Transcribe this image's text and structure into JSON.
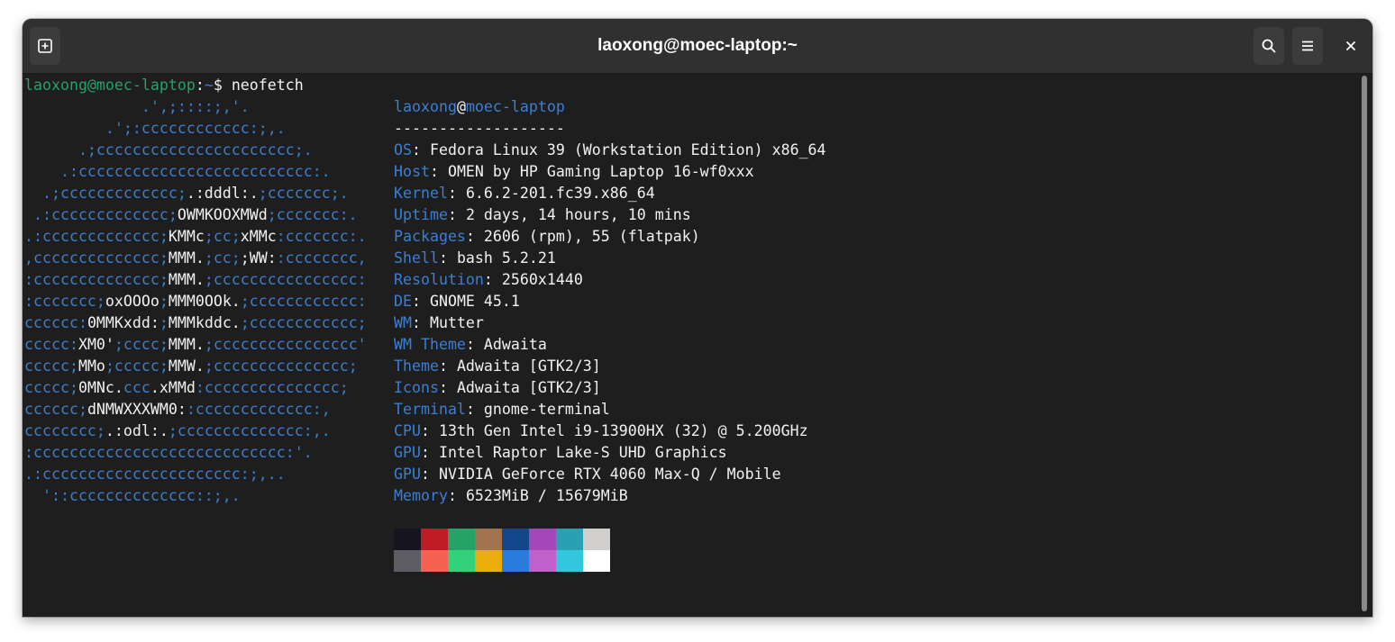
{
  "window": {
    "title": "laoxong@moec-laptop:~"
  },
  "header": {
    "new_tab_icon": "new-tab-icon",
    "search_icon": "search-icon",
    "menu_icon": "hamburger-menu-icon",
    "close_icon": "close-icon"
  },
  "prompt": {
    "user_host": "laoxong@moec-laptop",
    "sep": ":",
    "path": "~",
    "symbol": "$ ",
    "command": "neofetch"
  },
  "logo": [
    [
      [
        "b",
        "             .',;::::;,'."
      ]
    ],
    [
      [
        "b",
        "         .';:cccccccccccc:;,."
      ]
    ],
    [
      [
        "b",
        "      .;cccccccccccccccccccccc;."
      ]
    ],
    [
      [
        "b",
        "    .:cccccccccccccccccccccccccc:."
      ]
    ],
    [
      [
        "b",
        "  .;ccccccccccccc;"
      ],
      [
        "w",
        ".:dddl:."
      ],
      [
        "b",
        ";ccccccc;."
      ]
    ],
    [
      [
        "b",
        " .:ccccccccccccc;"
      ],
      [
        "w",
        "OWMKOOXMWd"
      ],
      [
        "b",
        ";ccccccc:."
      ]
    ],
    [
      [
        "b",
        ".:ccccccccccccc;"
      ],
      [
        "w",
        "KMMc"
      ],
      [
        "b",
        ";cc;"
      ],
      [
        "w",
        "xMMc"
      ],
      [
        "b",
        ":ccccccc:."
      ]
    ],
    [
      [
        "b",
        ",cccccccccccccc;"
      ],
      [
        "w",
        "MMM."
      ],
      [
        "b",
        ";cc;"
      ],
      [
        "w",
        ";WW:"
      ],
      [
        "b",
        ":cccccccc,"
      ]
    ],
    [
      [
        "b",
        ":cccccccccccccc;"
      ],
      [
        "w",
        "MMM."
      ],
      [
        "b",
        ";cccccccccccccccc:"
      ]
    ],
    [
      [
        "b",
        ":ccccccc;"
      ],
      [
        "w",
        "oxOOOo"
      ],
      [
        "b",
        ";"
      ],
      [
        "w",
        "MMM0OOk."
      ],
      [
        "b",
        ";cccccccccccc:"
      ]
    ],
    [
      [
        "b",
        "cccccc:"
      ],
      [
        "w",
        "0MMKxdd:"
      ],
      [
        "b",
        ";"
      ],
      [
        "w",
        "MMMkddc."
      ],
      [
        "b",
        ";cccccccccccc;"
      ]
    ],
    [
      [
        "b",
        "ccccc:"
      ],
      [
        "w",
        "XM0'"
      ],
      [
        "b",
        ";cccc;"
      ],
      [
        "w",
        "MMM."
      ],
      [
        "b",
        ";cccccccccccccccc'"
      ]
    ],
    [
      [
        "b",
        "ccccc;"
      ],
      [
        "w",
        "MMo"
      ],
      [
        "b",
        ";ccccc;"
      ],
      [
        "w",
        "MMW."
      ],
      [
        "b",
        ";ccccccccccccccc;"
      ]
    ],
    [
      [
        "b",
        "ccccc;"
      ],
      [
        "w",
        "0MNc."
      ],
      [
        "b",
        "ccc"
      ],
      [
        "w",
        ".xMMd"
      ],
      [
        "b",
        ":ccccccccccccccc;"
      ]
    ],
    [
      [
        "b",
        "cccccc;"
      ],
      [
        "w",
        "dNMWXXXWM0:"
      ],
      [
        "b",
        ":ccccccccccccc:,"
      ]
    ],
    [
      [
        "b",
        "cccccccc;"
      ],
      [
        "w",
        ".:odl:."
      ],
      [
        "b",
        ";cccccccccccccc:,."
      ]
    ],
    [
      [
        "b",
        ":cccccccccccccccccccccccccccc:'."
      ]
    ],
    [
      [
        "b",
        ".:cccccccccccccccccccccc:;,.."
      ]
    ],
    [
      [
        "b",
        "  '::cccccccccccccc::;,."
      ]
    ]
  ],
  "info_header": {
    "user": "laoxong",
    "at": "@",
    "host": "moec-laptop",
    "underline": "-------------------"
  },
  "info": [
    {
      "key": "OS",
      "value": "Fedora Linux 39 (Workstation Edition) x86_64"
    },
    {
      "key": "Host",
      "value": "OMEN by HP Gaming Laptop 16-wf0xxx"
    },
    {
      "key": "Kernel",
      "value": "6.6.2-201.fc39.x86_64"
    },
    {
      "key": "Uptime",
      "value": "2 days, 14 hours, 10 mins"
    },
    {
      "key": "Packages",
      "value": "2606 (rpm), 55 (flatpak)"
    },
    {
      "key": "Shell",
      "value": "bash 5.2.21"
    },
    {
      "key": "Resolution",
      "value": "2560x1440"
    },
    {
      "key": "DE",
      "value": "GNOME 45.1"
    },
    {
      "key": "WM",
      "value": "Mutter"
    },
    {
      "key": "WM Theme",
      "value": "Adwaita"
    },
    {
      "key": "Theme",
      "value": "Adwaita [GTK2/3]"
    },
    {
      "key": "Icons",
      "value": "Adwaita [GTK2/3]"
    },
    {
      "key": "Terminal",
      "value": "gnome-terminal"
    },
    {
      "key": "CPU",
      "value": "13th Gen Intel i9-13900HX (32) @ 5.200GHz"
    },
    {
      "key": "GPU",
      "value": "Intel Raptor Lake-S UHD Graphics"
    },
    {
      "key": "GPU",
      "value": "NVIDIA GeForce RTX 4060 Max-Q / Mobile"
    },
    {
      "key": "Memory",
      "value": "6523MiB / 15679MiB"
    }
  ],
  "palette": {
    "normal": [
      "#171421",
      "#c01c28",
      "#26a269",
      "#a2734c",
      "#12488b",
      "#a347ba",
      "#2aa1b3",
      "#d0cfcc"
    ],
    "bright": [
      "#5e5c64",
      "#f66151",
      "#33d17a",
      "#e9ad0c",
      "#2a7bde",
      "#c061cb",
      "#33c7de",
      "#ffffff"
    ]
  }
}
